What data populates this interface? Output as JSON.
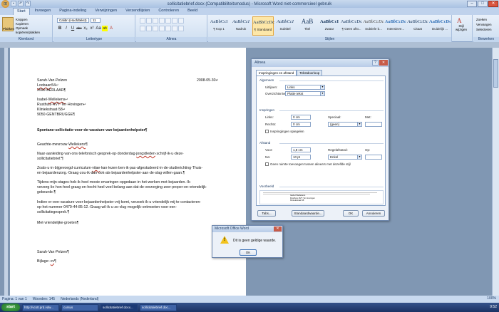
{
  "window": {
    "title": "sollicitatiebrief.docx (Compatibiliteitsmodus) - Microsoft Word niet-commercieel gebruik",
    "office_button": "⊞",
    "min": "–",
    "max": "□",
    "close": "✕"
  },
  "ribbon_tabs": [
    "Start",
    "Invoegen",
    "Pagina-indeling",
    "Verwijzingen",
    "Verzendlijsten",
    "Controleren",
    "Beeld"
  ],
  "clipboard": {
    "paste": "Plakken",
    "cut": "Knippen",
    "copy": "Kopiëren",
    "format": "Opmaak kopiëren/plakken",
    "label": "Klembord"
  },
  "font_group": {
    "font": "Calibri (Hoofdtekst)",
    "size": "11",
    "label": "Lettertype",
    "buttons": [
      "B",
      "I",
      "U",
      "abe",
      "x₂",
      "x²",
      "Aa",
      "ab",
      "A"
    ]
  },
  "paragraph_group": {
    "label": "Alinea"
  },
  "styles_group": {
    "label": "Stijlen",
    "items": [
      {
        "preview": "AaBbCcI",
        "name": "¶ Kop 1"
      },
      {
        "preview": "AaBbCcI",
        "name": "Nadruk"
      },
      {
        "preview": "AaBbCcDc",
        "name": "¶ Standaard"
      },
      {
        "preview": "AaBbCcI",
        "name": "Subtitel"
      },
      {
        "preview": "AaB",
        "name": "Titel"
      },
      {
        "preview": "AaBbCcI",
        "name": "Zwaar"
      },
      {
        "preview": "AaBbCcDc",
        "name": "¶ Geen afst..."
      },
      {
        "preview": "AaBbCcDc",
        "name": "Subtiele b..."
      },
      {
        "preview": "AaBbCcDc",
        "name": "Intensieve..."
      },
      {
        "preview": "AaBbCcDc",
        "name": "Citaat"
      },
      {
        "preview": "AaBbCcDc",
        "name": "Duidelijk ..."
      }
    ],
    "change": "Stijl wijzigen"
  },
  "editing_group": {
    "label": "Bewerken",
    "find": "Zoeken",
    "replace": "Vervangen",
    "select": "Selecteren"
  },
  "document": {
    "sender_name": "Sarah·Van·Pelzen",
    "date": "2008-05-30↵",
    "sender_street_a": "Loobaan",
    "sender_street_b": "54↵",
    "sender_city": "2590·BERLAAR¶",
    "recipient_name_a": "Isabel·",
    "recipient_name_b": "Wellekens",
    "recipient_name_c": "↵",
    "recipient_org": "Rusthuis·RVT·Ter·Hovingen↵",
    "recipient_street": "Kliniekstraat·58↵",
    "recipient_city": "9050·GENTBRUGGE¶",
    "subject": "Spontane·sollicitatie·voor·de·vacature·van·bejaardenhelpster¶",
    "salutation_a": "Geachte·mevrouw·",
    "salutation_b": "Wellekens",
    "salutation_c": "¶",
    "p1_l1a": "Naar·aanleiding·van·ons·telefonisch·gesprek·op·donderdag·",
    "p1_l1b": "jongstleden",
    "p1_l1c": "·schrijf·ik·u·deze·",
    "p1_l2": "sollicitatiebrief.¶",
    "p2_l1a": "Zoals·u·in·bijgevoegd·curriculum·",
    "p2_l1b": "vitae",
    "p2_l1c": "·kan·lezen·ben·ik·pas·afgestudeerd·in·de·studierichting·Thuis-",
    "p2_l2": "en·bejaardenzorg.·Graag·zou·ik·dan·ook·als·bejaardenhelpster·aan·de·slag·willen·gaan.¶",
    "p3_l1": "Tijdens·mijn·stages·heb·ik·heel·mooie·ervaringen·opgedaan·in·het·werken·met·bejaarden.·Ik·",
    "p3_l2": "verzorg·lie·hon·heel·graag·en·hecht·heel·veel·belang·aan·dat·de·verzorging·zeer·proper·en·vriendelijk·",
    "p3_l3": "gebeurde.¶",
    "p4_l1": "Indien·er·een·vacature·voor·bejaardenhelpster·vrij·komt,·verzoek·ik·u·vriendelijk·mij·te·contacteren·",
    "p4_l2": "op·het·nummer·0479-44-85-12.·Graag·wil·ik·u·zo·vlug·mogelijk·ontmoeten·voor·een·",
    "p4_l3": "sollicitatiegesprek.¶",
    "closing": "Met·vriendelijke·groeten¶",
    "signature": "Sarah·Van·Pelzen¶",
    "attachment_a": "Bijlage:·",
    "attachment_b": "cv",
    "attachment_c": "¶"
  },
  "status_bar": {
    "page": "Pagina: 1 van 1",
    "words": "Woorden: 145",
    "language": "Nederlands (Nederland)",
    "zoom": "100%"
  },
  "taskbar": {
    "start": "start",
    "tasks": [
      "http://vcs0.prd.vdw...",
      "cursus",
      "sollicitatiebrief.docx...",
      "sollicitatiebrief.doc..."
    ],
    "clock": "9:52"
  },
  "paragraph_dialog": {
    "title": "Alinea",
    "help": "?",
    "close": "✕",
    "tabs": [
      "Inspringingen en afstand",
      "Tekstdoorloop"
    ],
    "general_label": "Algemeen",
    "alignment_label": "Uitlijnen:",
    "alignment_value": "Links",
    "outline_label": "Overzichtsniveau:",
    "outline_value": "Platte tekst",
    "indent_label": "Inspringen",
    "left_label": "Links:",
    "left_value": "0 cm",
    "right_label": "Rechts:",
    "right_value": "0 cm",
    "special_label": "Speciaal:",
    "special_value": "(geen)",
    "by_label": "Met:",
    "by_value": "",
    "mirror_label": "Inspringingen spiegelen",
    "spacing_label": "Afstand",
    "before_label": "Voor:",
    "before_value": "1,8 cm",
    "after_label": "Na:",
    "after_value": "10 pt",
    "line_label": "Regelafstand:",
    "line_value": "Enkel",
    "at_label": "Op:",
    "at_value": "",
    "nospace_label": "Geen ruimte toevoegen tussen alinea's met dezelfde stijl",
    "preview_label": "Voorbeeld",
    "preview_lines": [
      "Isabel·Wellekens",
      "Rusthuis·RVT·Ter·Hovingen",
      "Kliniekstraat·58",
      "9050·GENTBRUGGE"
    ],
    "tabs_button": "Tabs...",
    "default_button": "Standaardwaarde...",
    "ok_button": "OK",
    "cancel_button": "Annuleren"
  },
  "message_box": {
    "title": "Microsoft Office Word",
    "message": "Dit is geen geldige waarde.",
    "ok": "OK",
    "close": "✕"
  }
}
